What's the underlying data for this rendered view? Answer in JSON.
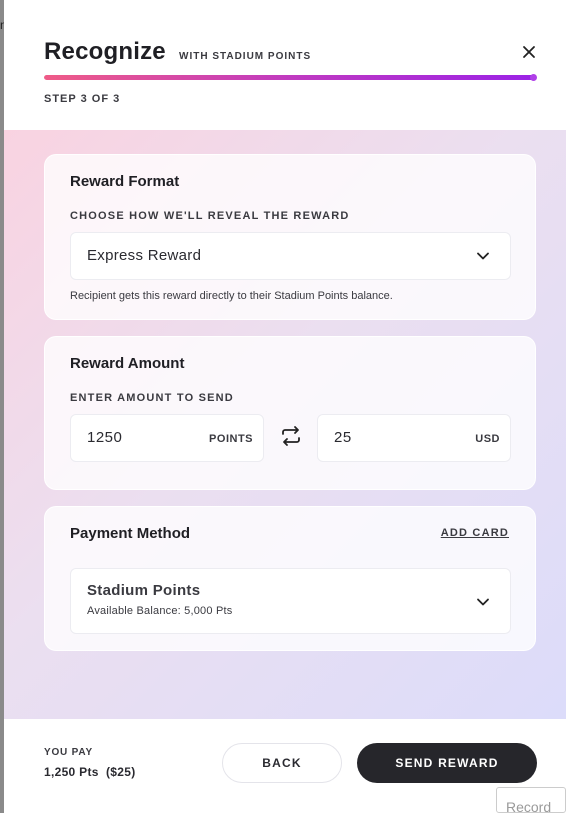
{
  "modal": {
    "title": "Recognize",
    "subtitle": "WITH STADIUM POINTS",
    "close_icon": "close-icon",
    "step": "STEP 3 OF 3",
    "progress": 1.0,
    "progress_colors": [
      "#ef5b87",
      "#c03ac0",
      "#9b22e6"
    ]
  },
  "reward_format": {
    "title": "Reward Format",
    "label": "CHOOSE HOW WE'LL REVEAL THE REWARD",
    "selected": "Express Reward",
    "help": "Recipient gets this reward directly to their Stadium Points balance."
  },
  "reward_amount": {
    "title": "Reward Amount",
    "label": "ENTER AMOUNT TO SEND",
    "points_value": "1250",
    "points_unit": "POINTS",
    "usd_value": "25",
    "usd_unit": "USD",
    "swap_icon": "swap-arrows-icon"
  },
  "payment_method": {
    "title": "Payment Method",
    "add_card": "ADD CARD",
    "selected_title": "Stadium Points",
    "selected_sub": "Available Balance: 5,000 Pts"
  },
  "footer": {
    "pay_label": "YOU PAY",
    "pay_value": "1,250 Pts  ($25)",
    "back": "BACK",
    "send": "SEND REWARD",
    "send_color": "#26262b"
  },
  "background": {
    "mark": "n",
    "record_tag": "Record"
  }
}
